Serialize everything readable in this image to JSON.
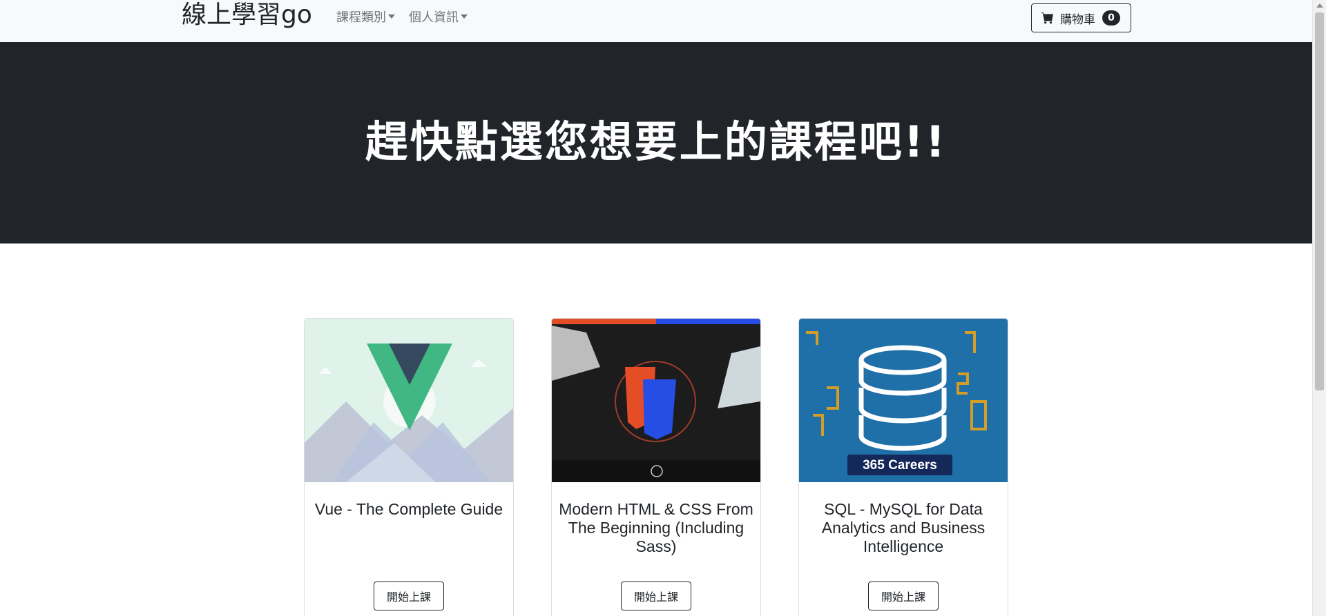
{
  "navbar": {
    "brand": "線上學習go",
    "menu": [
      {
        "label": "課程類別"
      },
      {
        "label": "個人資訊"
      }
    ],
    "cart": {
      "label": "購物車",
      "count": "0",
      "icon": "cart-icon"
    }
  },
  "hero": {
    "title": "趕快點選您想要上的課程吧!!"
  },
  "courses": [
    {
      "title": "Vue - The Complete Guide",
      "button": "開始上課"
    },
    {
      "title": "Modern HTML & CSS From The Beginning (Including Sass)",
      "button": "開始上課"
    },
    {
      "title": "SQL - MySQL for Data Analytics and Business Intelligence",
      "button": "開始上課",
      "image_caption": "365 Careers"
    }
  ],
  "colors": {
    "dark": "#212529",
    "nav_bg": "#f8f9fa",
    "muted": "#6c757d"
  }
}
